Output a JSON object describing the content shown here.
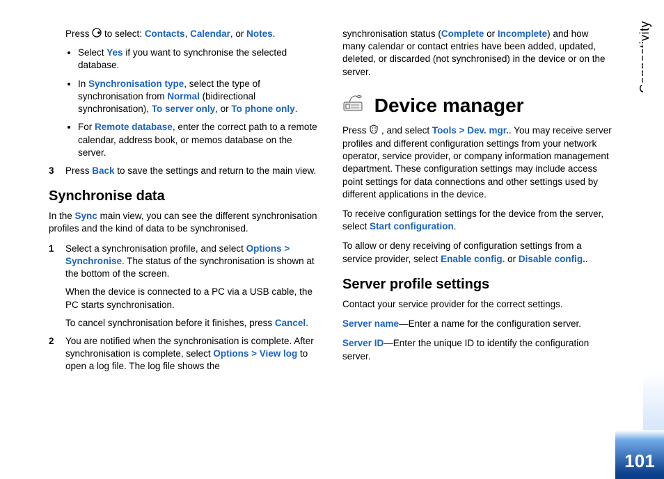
{
  "side_tab": "Connectivity",
  "page_number": "101",
  "left": {
    "press_line": {
      "pre": "Press ",
      "post1": " to select: ",
      "a": "Contacts",
      "b": "Calendar",
      "or": ", or ",
      "c": "Notes",
      "end": "."
    },
    "bullets": {
      "b1_pre": "Select ",
      "b1_link": "Yes",
      "b1_post": " if you want to synchronise the selected database.",
      "b2_pre": "In ",
      "b2_l1": "Synchronisation type",
      "b2_mid1": ", select the type of synchronisation from ",
      "b2_l2": "Normal",
      "b2_mid2": " (bidirectional synchronisation), ",
      "b2_l3": "To server only",
      "b2_mid3": ", or ",
      "b2_l4": "To phone only",
      "b2_end": ".",
      "b3_pre": "For ",
      "b3_l1": "Remote database",
      "b3_post": ", enter the correct path to a remote calendar, address book, or memos database on the server."
    },
    "step3": {
      "n": "3",
      "pre": "Press ",
      "link": "Back",
      "post": " to save the settings and return to the main view."
    },
    "h_sync": "Synchronise data",
    "sync_p": {
      "pre": "In the ",
      "link": "Sync",
      "post": " main view, you can see the different synchronisation profiles and the kind of data to be synchronised."
    },
    "s1": {
      "n": "1",
      "pre": "Select a synchronisation profile, and select ",
      "link": "Options > Synchronise",
      "post": ". The status of the synchronisation is shown at the bottom of the screen.",
      "sub1": "When the device is connected to a PC via a USB cable, the PC starts synchronisation.",
      "sub2_pre": "To cancel synchronisation before it finishes, press ",
      "sub2_link": "Cancel",
      "sub2_post": "."
    },
    "s2": {
      "n": "2",
      "pre": "You are notified when the synchronisation is complete. After synchronisation is complete, select ",
      "link": "Options > View log",
      "post": " to open a log file. The log file shows the"
    }
  },
  "right": {
    "cont": {
      "pre": "synchronisation status (",
      "l1": "Complete",
      "mid": " or ",
      "l2": "Incomplete",
      "post": ") and how many calendar or contact entries have been added, updated, deleted, or discarded (not synchronised) in the device or on the server."
    },
    "h_dev": "Device manager",
    "p1": {
      "pre": "Press ",
      "mid": ", and select ",
      "link": "Tools > Dev. mgr.",
      "post": ". You may receive server profiles and different configuration settings from your network operator, service provider, or company information management department. These configuration settings may include access point settings for data connections and other settings used by different applications in the device."
    },
    "p2": {
      "pre": "To receive configuration settings for the device from the server, select ",
      "link": "Start configuration",
      "post": "."
    },
    "p3": {
      "pre": "To allow or deny receiving of configuration settings from a service provider, select ",
      "l1": "Enable config.",
      "mid": " or ",
      "l2": "Disable config.",
      "post": "."
    },
    "h_srv": "Server profile settings",
    "srv_intro": "Contact your service provider for the correct settings.",
    "srv1_l": "Server name",
    "srv1_t": "—Enter a name for the configuration server.",
    "srv2_l": "Server ID",
    "srv2_t": "—Enter the unique ID to identify the configuration server."
  }
}
